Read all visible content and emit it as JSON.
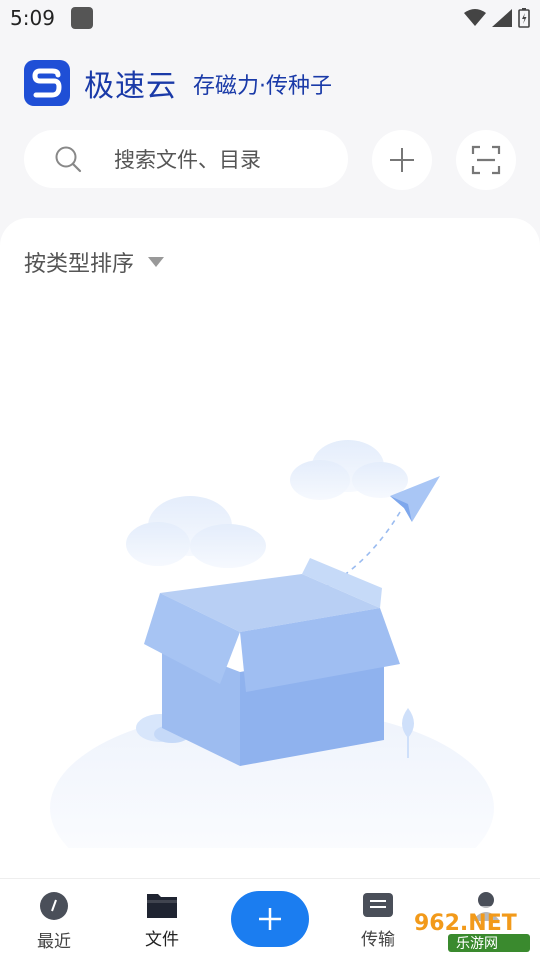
{
  "status_bar": {
    "time": "5:09"
  },
  "header": {
    "app_name": "极速云",
    "slogan": "存磁力·传种子",
    "brand_color": "#1a3aa8"
  },
  "search": {
    "placeholder": "搜索文件、目录"
  },
  "toolbar": {
    "add_icon": "plus-icon",
    "scan_icon": "scan-icon"
  },
  "content": {
    "sort_label": "按类型排序",
    "empty_illustration": "empty-box-illustration"
  },
  "bottom_nav": {
    "items": [
      {
        "label": "最近",
        "icon": "recent-icon"
      },
      {
        "label": "文件",
        "icon": "folder-icon",
        "active": true
      },
      {
        "label": "",
        "icon": "plus-icon"
      },
      {
        "label": "传输",
        "icon": "transfer-icon"
      },
      {
        "label": "",
        "icon": "profile-icon"
      }
    ],
    "accent": "#1b7df0"
  },
  "watermark": {
    "text_top": "962.NET",
    "text_bottom": "乐游网"
  }
}
